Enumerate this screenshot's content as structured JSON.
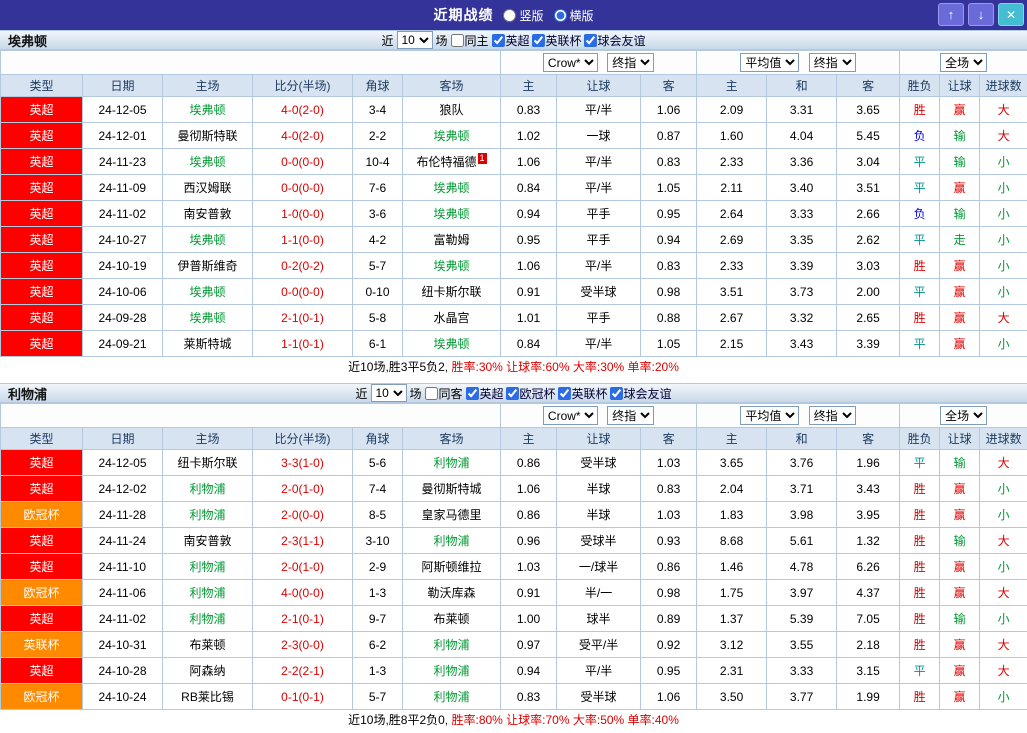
{
  "topbar": {
    "title": "近期战绩",
    "vertical_label": "竖版",
    "horizontal_label": "横版",
    "selected": "横版",
    "up_icon": "↑",
    "down_icon": "↓",
    "close_icon": "✕"
  },
  "header": {
    "bookmaker": "Crow*",
    "final": "终指",
    "average": "平均值",
    "fulltime": "全场",
    "cols": [
      "类型",
      "日期",
      "主场",
      "比分(半场)",
      "角球",
      "客场",
      "主",
      "让球",
      "客",
      "主",
      "和",
      "客",
      "胜负",
      "让球",
      "进球数"
    ]
  },
  "colors": {
    "league": {
      "英超": "#ff0000",
      "欧冠杯": "#ff8a00",
      "英联杯": "#ff8a00"
    },
    "result": {
      "胜": "#dd0000",
      "平": "#009288",
      "负": "#0000dd"
    },
    "handicap_result": {
      "赢": "#dd0000",
      "输": "#009933",
      "走": "#009933"
    },
    "goals": {
      "大": "#dd0000",
      "小": "#009933"
    },
    "team_highlight": "#009933",
    "score": "#dd0000"
  },
  "sections": [
    {
      "team": "埃弗顿",
      "filter": {
        "near_label": "近",
        "count": "10",
        "games_label": "场",
        "same_label": "同主",
        "leagues": [
          "英超",
          "英联杯",
          "球会友谊"
        ]
      },
      "rows": [
        {
          "league": "英超",
          "date": "24-12-05",
          "home": "埃弗顿",
          "score": "4-0(2-0)",
          "corners": "3-4",
          "away": "狼队",
          "o1": "0.83",
          "h": "平/半",
          "o2": "1.06",
          "e1": "2.09",
          "e2": "3.31",
          "e3": "3.65",
          "r": "胜",
          "hr": "赢",
          "g": "大"
        },
        {
          "league": "英超",
          "date": "24-12-01",
          "home": "曼彻斯特联",
          "score": "4-0(2-0)",
          "corners": "2-2",
          "away": "埃弗顿",
          "o1": "1.02",
          "h": "一球",
          "o2": "0.87",
          "e1": "1.60",
          "e2": "4.04",
          "e3": "5.45",
          "r": "负",
          "hr": "输",
          "g": "大"
        },
        {
          "league": "英超",
          "date": "24-11-23",
          "home": "埃弗顿",
          "score": "0-0(0-0)",
          "corners": "10-4",
          "away": "布伦特福德",
          "badge": "1",
          "o1": "1.06",
          "h": "平/半",
          "o2": "0.83",
          "e1": "2.33",
          "e2": "3.36",
          "e3": "3.04",
          "r": "平",
          "hr": "输",
          "g": "小"
        },
        {
          "league": "英超",
          "date": "24-11-09",
          "home": "西汉姆联",
          "score": "0-0(0-0)",
          "corners": "7-6",
          "away": "埃弗顿",
          "o1": "0.84",
          "h": "平/半",
          "o2": "1.05",
          "e1": "2.11",
          "e2": "3.40",
          "e3": "3.51",
          "r": "平",
          "hr": "赢",
          "g": "小"
        },
        {
          "league": "英超",
          "date": "24-11-02",
          "home": "南安普敦",
          "score": "1-0(0-0)",
          "corners": "3-6",
          "away": "埃弗顿",
          "o1": "0.94",
          "h": "平手",
          "o2": "0.95",
          "e1": "2.64",
          "e2": "3.33",
          "e3": "2.66",
          "r": "负",
          "hr": "输",
          "g": "小"
        },
        {
          "league": "英超",
          "date": "24-10-27",
          "home": "埃弗顿",
          "score": "1-1(0-0)",
          "corners": "4-2",
          "away": "富勒姆",
          "o1": "0.95",
          "h": "平手",
          "o2": "0.94",
          "e1": "2.69",
          "e2": "3.35",
          "e3": "2.62",
          "r": "平",
          "hr": "走",
          "g": "小"
        },
        {
          "league": "英超",
          "date": "24-10-19",
          "home": "伊普斯维奇",
          "score": "0-2(0-2)",
          "corners": "5-7",
          "away": "埃弗顿",
          "o1": "1.06",
          "h": "平/半",
          "o2": "0.83",
          "e1": "2.33",
          "e2": "3.39",
          "e3": "3.03",
          "r": "胜",
          "hr": "赢",
          "g": "小"
        },
        {
          "league": "英超",
          "date": "24-10-06",
          "home": "埃弗顿",
          "score": "0-0(0-0)",
          "corners": "0-10",
          "away": "纽卡斯尔联",
          "o1": "0.91",
          "h": "受半球",
          "o2": "0.98",
          "e1": "3.51",
          "e2": "3.73",
          "e3": "2.00",
          "r": "平",
          "hr": "赢",
          "g": "小"
        },
        {
          "league": "英超",
          "date": "24-09-28",
          "home": "埃弗顿",
          "score": "2-1(0-1)",
          "corners": "5-8",
          "away": "水晶宫",
          "o1": "1.01",
          "h": "平手",
          "o2": "0.88",
          "e1": "2.67",
          "e2": "3.32",
          "e3": "2.65",
          "r": "胜",
          "hr": "赢",
          "g": "大"
        },
        {
          "league": "英超",
          "date": "24-09-21",
          "home": "莱斯特城",
          "score": "1-1(0-1)",
          "corners": "6-1",
          "away": "埃弗顿",
          "o1": "0.84",
          "h": "平/半",
          "o2": "1.05",
          "e1": "2.15",
          "e2": "3.43",
          "e3": "3.39",
          "r": "平",
          "hr": "赢",
          "g": "小"
        }
      ],
      "summary_record": "近10场,胜3平5负2,",
      "summary_rates": "胜率:30% 让球率:60% 大率:30% 单率:20%"
    },
    {
      "team": "利物浦",
      "filter": {
        "near_label": "近",
        "count": "10",
        "games_label": "场",
        "same_label": "同客",
        "leagues": [
          "英超",
          "欧冠杯",
          "英联杯",
          "球会友谊"
        ]
      },
      "rows": [
        {
          "league": "英超",
          "date": "24-12-05",
          "home": "纽卡斯尔联",
          "score": "3-3(1-0)",
          "corners": "5-6",
          "away": "利物浦",
          "o1": "0.86",
          "h": "受半球",
          "o2": "1.03",
          "e1": "3.65",
          "e2": "3.76",
          "e3": "1.96",
          "r": "平",
          "hr": "输",
          "g": "大"
        },
        {
          "league": "英超",
          "date": "24-12-02",
          "home": "利物浦",
          "score": "2-0(1-0)",
          "corners": "7-4",
          "away": "曼彻斯特城",
          "o1": "1.06",
          "h": "半球",
          "o2": "0.83",
          "e1": "2.04",
          "e2": "3.71",
          "e3": "3.43",
          "r": "胜",
          "hr": "赢",
          "g": "小"
        },
        {
          "league": "欧冠杯",
          "date": "24-11-28",
          "home": "利物浦",
          "score": "2-0(0-0)",
          "corners": "8-5",
          "away": "皇家马德里",
          "o1": "0.86",
          "h": "半球",
          "o2": "1.03",
          "e1": "1.83",
          "e2": "3.98",
          "e3": "3.95",
          "r": "胜",
          "hr": "赢",
          "g": "小"
        },
        {
          "league": "英超",
          "date": "24-11-24",
          "home": "南安普敦",
          "score": "2-3(1-1)",
          "corners": "3-10",
          "away": "利物浦",
          "o1": "0.96",
          "h": "受球半",
          "o2": "0.93",
          "e1": "8.68",
          "e2": "5.61",
          "e3": "1.32",
          "r": "胜",
          "hr": "输",
          "g": "大"
        },
        {
          "league": "英超",
          "date": "24-11-10",
          "home": "利物浦",
          "score": "2-0(1-0)",
          "corners": "2-9",
          "away": "阿斯顿维拉",
          "o1": "1.03",
          "h": "一/球半",
          "o2": "0.86",
          "e1": "1.46",
          "e2": "4.78",
          "e3": "6.26",
          "r": "胜",
          "hr": "赢",
          "g": "小"
        },
        {
          "league": "欧冠杯",
          "date": "24-11-06",
          "home": "利物浦",
          "score": "4-0(0-0)",
          "corners": "1-3",
          "away": "勒沃库森",
          "o1": "0.91",
          "h": "半/一",
          "o2": "0.98",
          "e1": "1.75",
          "e2": "3.97",
          "e3": "4.37",
          "r": "胜",
          "hr": "赢",
          "g": "大"
        },
        {
          "league": "英超",
          "date": "24-11-02",
          "home": "利物浦",
          "score": "2-1(0-1)",
          "corners": "9-7",
          "away": "布莱顿",
          "o1": "1.00",
          "h": "球半",
          "o2": "0.89",
          "e1": "1.37",
          "e2": "5.39",
          "e3": "7.05",
          "r": "胜",
          "hr": "输",
          "g": "小"
        },
        {
          "league": "英联杯",
          "date": "24-10-31",
          "home": "布莱顿",
          "score": "2-3(0-0)",
          "corners": "6-2",
          "away": "利物浦",
          "o1": "0.97",
          "h": "受平/半",
          "o2": "0.92",
          "e1": "3.12",
          "e2": "3.55",
          "e3": "2.18",
          "r": "胜",
          "hr": "赢",
          "g": "大"
        },
        {
          "league": "英超",
          "date": "24-10-28",
          "home": "阿森纳",
          "score": "2-2(2-1)",
          "corners": "1-3",
          "away": "利物浦",
          "o1": "0.94",
          "h": "平/半",
          "o2": "0.95",
          "e1": "2.31",
          "e2": "3.33",
          "e3": "3.15",
          "r": "平",
          "hr": "赢",
          "g": "大"
        },
        {
          "league": "欧冠杯",
          "date": "24-10-24",
          "home": "RB莱比锡",
          "score": "0-1(0-1)",
          "corners": "5-7",
          "away": "利物浦",
          "o1": "0.83",
          "h": "受半球",
          "o2": "1.06",
          "e1": "3.50",
          "e2": "3.77",
          "e3": "1.99",
          "r": "胜",
          "hr": "赢",
          "g": "小"
        }
      ],
      "summary_record": "近10场,胜8平2负0,",
      "summary_rates": "胜率:80% 让球率:70% 大率:50% 单率:40%"
    }
  ]
}
